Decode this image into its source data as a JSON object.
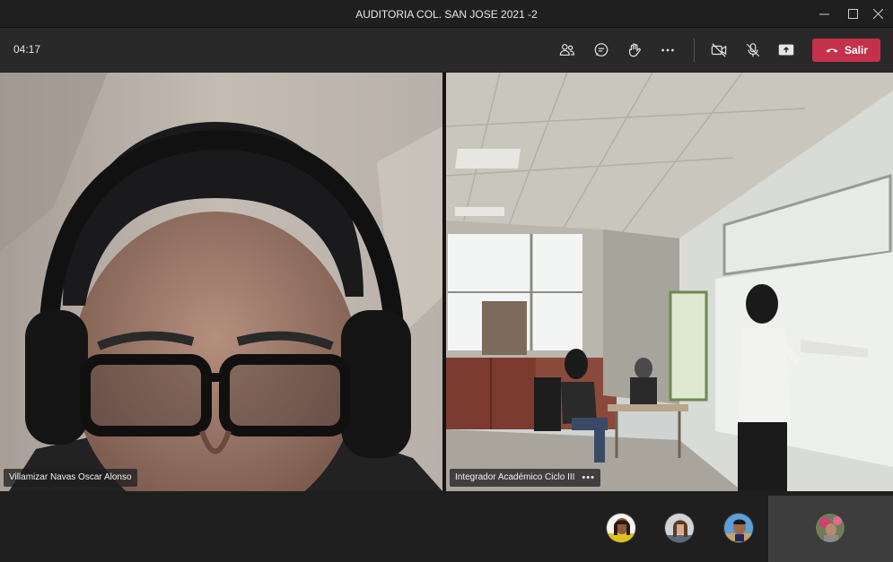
{
  "window": {
    "title": "AUDITORIA COL. SAN JOSE 2021 -2",
    "controls": [
      "minimize-icon",
      "maximize-icon",
      "close-icon"
    ]
  },
  "toolbar": {
    "timer": "04:17",
    "buttons": [
      "participants-icon",
      "chat-icon",
      "raise-hand-icon",
      "more-icon",
      "camera-off-icon",
      "mic-off-icon",
      "share-screen-icon"
    ],
    "leave_label": "Salir",
    "leave_color": "#c4314b"
  },
  "stage": {
    "participants": [
      {
        "name": "Villamizar Navas Oscar Alonso"
      },
      {
        "name": "Integrador Académico Ciclo III",
        "more": "•••"
      }
    ]
  },
  "bottom_bar": {
    "avatars": [
      "avatar-1",
      "avatar-2",
      "avatar-3"
    ],
    "self_view": "self-avatar"
  }
}
